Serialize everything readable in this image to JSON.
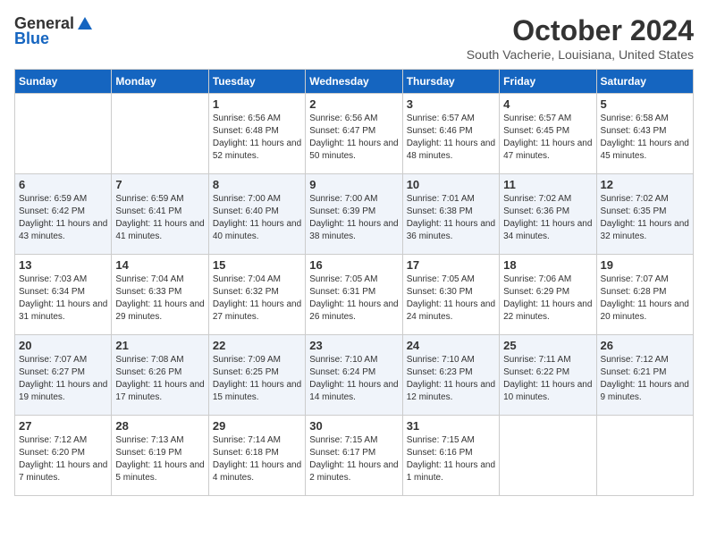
{
  "logo": {
    "general": "General",
    "blue": "Blue"
  },
  "title": "October 2024",
  "location": "South Vacherie, Louisiana, United States",
  "days_of_week": [
    "Sunday",
    "Monday",
    "Tuesday",
    "Wednesday",
    "Thursday",
    "Friday",
    "Saturday"
  ],
  "weeks": [
    [
      {
        "day": "",
        "sunrise": "",
        "sunset": "",
        "daylight": ""
      },
      {
        "day": "",
        "sunrise": "",
        "sunset": "",
        "daylight": ""
      },
      {
        "day": "1",
        "sunrise": "Sunrise: 6:56 AM",
        "sunset": "Sunset: 6:48 PM",
        "daylight": "Daylight: 11 hours and 52 minutes."
      },
      {
        "day": "2",
        "sunrise": "Sunrise: 6:56 AM",
        "sunset": "Sunset: 6:47 PM",
        "daylight": "Daylight: 11 hours and 50 minutes."
      },
      {
        "day": "3",
        "sunrise": "Sunrise: 6:57 AM",
        "sunset": "Sunset: 6:46 PM",
        "daylight": "Daylight: 11 hours and 48 minutes."
      },
      {
        "day": "4",
        "sunrise": "Sunrise: 6:57 AM",
        "sunset": "Sunset: 6:45 PM",
        "daylight": "Daylight: 11 hours and 47 minutes."
      },
      {
        "day": "5",
        "sunrise": "Sunrise: 6:58 AM",
        "sunset": "Sunset: 6:43 PM",
        "daylight": "Daylight: 11 hours and 45 minutes."
      }
    ],
    [
      {
        "day": "6",
        "sunrise": "Sunrise: 6:59 AM",
        "sunset": "Sunset: 6:42 PM",
        "daylight": "Daylight: 11 hours and 43 minutes."
      },
      {
        "day": "7",
        "sunrise": "Sunrise: 6:59 AM",
        "sunset": "Sunset: 6:41 PM",
        "daylight": "Daylight: 11 hours and 41 minutes."
      },
      {
        "day": "8",
        "sunrise": "Sunrise: 7:00 AM",
        "sunset": "Sunset: 6:40 PM",
        "daylight": "Daylight: 11 hours and 40 minutes."
      },
      {
        "day": "9",
        "sunrise": "Sunrise: 7:00 AM",
        "sunset": "Sunset: 6:39 PM",
        "daylight": "Daylight: 11 hours and 38 minutes."
      },
      {
        "day": "10",
        "sunrise": "Sunrise: 7:01 AM",
        "sunset": "Sunset: 6:38 PM",
        "daylight": "Daylight: 11 hours and 36 minutes."
      },
      {
        "day": "11",
        "sunrise": "Sunrise: 7:02 AM",
        "sunset": "Sunset: 6:36 PM",
        "daylight": "Daylight: 11 hours and 34 minutes."
      },
      {
        "day": "12",
        "sunrise": "Sunrise: 7:02 AM",
        "sunset": "Sunset: 6:35 PM",
        "daylight": "Daylight: 11 hours and 32 minutes."
      }
    ],
    [
      {
        "day": "13",
        "sunrise": "Sunrise: 7:03 AM",
        "sunset": "Sunset: 6:34 PM",
        "daylight": "Daylight: 11 hours and 31 minutes."
      },
      {
        "day": "14",
        "sunrise": "Sunrise: 7:04 AM",
        "sunset": "Sunset: 6:33 PM",
        "daylight": "Daylight: 11 hours and 29 minutes."
      },
      {
        "day": "15",
        "sunrise": "Sunrise: 7:04 AM",
        "sunset": "Sunset: 6:32 PM",
        "daylight": "Daylight: 11 hours and 27 minutes."
      },
      {
        "day": "16",
        "sunrise": "Sunrise: 7:05 AM",
        "sunset": "Sunset: 6:31 PM",
        "daylight": "Daylight: 11 hours and 26 minutes."
      },
      {
        "day": "17",
        "sunrise": "Sunrise: 7:05 AM",
        "sunset": "Sunset: 6:30 PM",
        "daylight": "Daylight: 11 hours and 24 minutes."
      },
      {
        "day": "18",
        "sunrise": "Sunrise: 7:06 AM",
        "sunset": "Sunset: 6:29 PM",
        "daylight": "Daylight: 11 hours and 22 minutes."
      },
      {
        "day": "19",
        "sunrise": "Sunrise: 7:07 AM",
        "sunset": "Sunset: 6:28 PM",
        "daylight": "Daylight: 11 hours and 20 minutes."
      }
    ],
    [
      {
        "day": "20",
        "sunrise": "Sunrise: 7:07 AM",
        "sunset": "Sunset: 6:27 PM",
        "daylight": "Daylight: 11 hours and 19 minutes."
      },
      {
        "day": "21",
        "sunrise": "Sunrise: 7:08 AM",
        "sunset": "Sunset: 6:26 PM",
        "daylight": "Daylight: 11 hours and 17 minutes."
      },
      {
        "day": "22",
        "sunrise": "Sunrise: 7:09 AM",
        "sunset": "Sunset: 6:25 PM",
        "daylight": "Daylight: 11 hours and 15 minutes."
      },
      {
        "day": "23",
        "sunrise": "Sunrise: 7:10 AM",
        "sunset": "Sunset: 6:24 PM",
        "daylight": "Daylight: 11 hours and 14 minutes."
      },
      {
        "day": "24",
        "sunrise": "Sunrise: 7:10 AM",
        "sunset": "Sunset: 6:23 PM",
        "daylight": "Daylight: 11 hours and 12 minutes."
      },
      {
        "day": "25",
        "sunrise": "Sunrise: 7:11 AM",
        "sunset": "Sunset: 6:22 PM",
        "daylight": "Daylight: 11 hours and 10 minutes."
      },
      {
        "day": "26",
        "sunrise": "Sunrise: 7:12 AM",
        "sunset": "Sunset: 6:21 PM",
        "daylight": "Daylight: 11 hours and 9 minutes."
      }
    ],
    [
      {
        "day": "27",
        "sunrise": "Sunrise: 7:12 AM",
        "sunset": "Sunset: 6:20 PM",
        "daylight": "Daylight: 11 hours and 7 minutes."
      },
      {
        "day": "28",
        "sunrise": "Sunrise: 7:13 AM",
        "sunset": "Sunset: 6:19 PM",
        "daylight": "Daylight: 11 hours and 5 minutes."
      },
      {
        "day": "29",
        "sunrise": "Sunrise: 7:14 AM",
        "sunset": "Sunset: 6:18 PM",
        "daylight": "Daylight: 11 hours and 4 minutes."
      },
      {
        "day": "30",
        "sunrise": "Sunrise: 7:15 AM",
        "sunset": "Sunset: 6:17 PM",
        "daylight": "Daylight: 11 hours and 2 minutes."
      },
      {
        "day": "31",
        "sunrise": "Sunrise: 7:15 AM",
        "sunset": "Sunset: 6:16 PM",
        "daylight": "Daylight: 11 hours and 1 minute."
      },
      {
        "day": "",
        "sunrise": "",
        "sunset": "",
        "daylight": ""
      },
      {
        "day": "",
        "sunrise": "",
        "sunset": "",
        "daylight": ""
      }
    ]
  ],
  "row_classes": [
    "row-normal",
    "row-alt",
    "row-normal",
    "row-alt",
    "row-normal"
  ]
}
